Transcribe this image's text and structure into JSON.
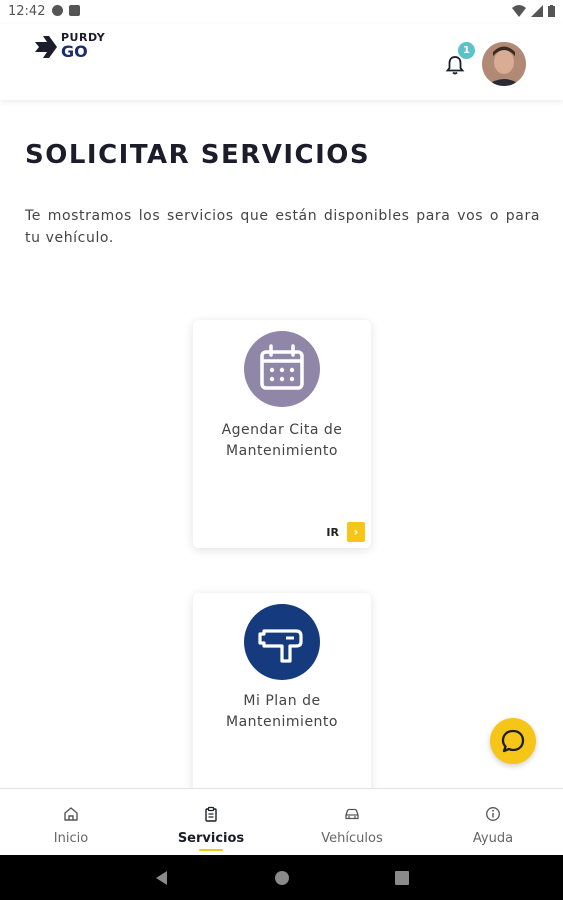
{
  "status_bar": {
    "time": "12:42"
  },
  "header": {
    "logo_top": "PURDY",
    "logo_bottom": "GO",
    "notification_count": "1"
  },
  "main": {
    "title": "SOLICITAR SERVICIOS",
    "description": "Te mostramos los servicios que están disponibles para vos o para tu vehículo.",
    "services": [
      {
        "title_line1": "Agendar Cita de",
        "title_line2": "Mantenimiento",
        "action_label": "IR",
        "icon": "calendar-icon",
        "color": "#8f86a8"
      },
      {
        "title_line1": "Mi Plan de",
        "title_line2": "Mantenimiento",
        "icon": "spray-gun-icon",
        "color": "#153a7e"
      }
    ]
  },
  "bottom_nav": {
    "items": [
      {
        "label": "Inicio",
        "icon": "home-icon"
      },
      {
        "label": "Servicios",
        "icon": "clipboard-icon",
        "active": true
      },
      {
        "label": "Vehículos",
        "icon": "car-icon"
      },
      {
        "label": "Ayuda",
        "icon": "info-icon"
      }
    ]
  },
  "colors": {
    "accent": "#f5c518",
    "badge": "#5bc2c8"
  }
}
